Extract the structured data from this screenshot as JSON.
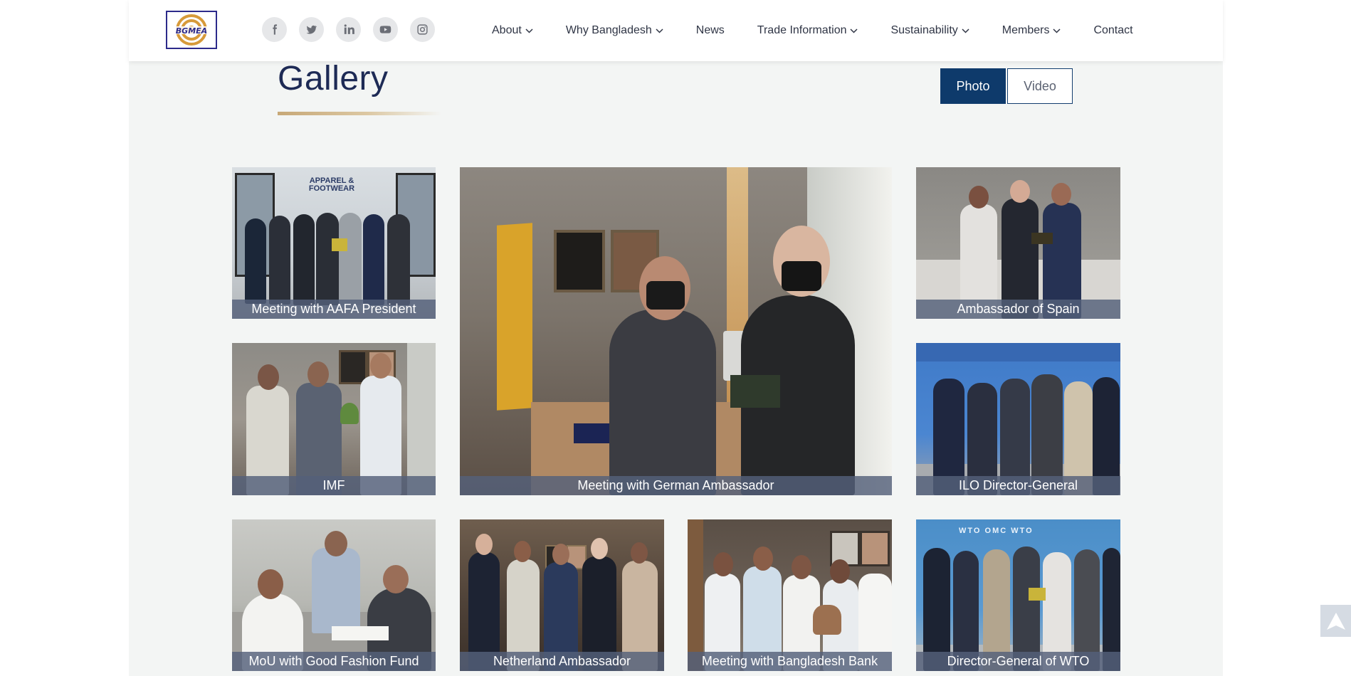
{
  "brand": {
    "logo_text": "BGMEA"
  },
  "nav": {
    "socials": [
      {
        "icon": "facebook-icon"
      },
      {
        "icon": "twitter-icon"
      },
      {
        "icon": "linkedin-icon"
      },
      {
        "icon": "youtube-icon"
      },
      {
        "icon": "instagram-icon"
      }
    ],
    "menu": [
      {
        "label": "About",
        "dropdown": true
      },
      {
        "label": "Why Bangladesh",
        "dropdown": true
      },
      {
        "label": "News",
        "dropdown": false
      },
      {
        "label": "Trade Information",
        "dropdown": true
      },
      {
        "label": "Sustainability",
        "dropdown": true
      },
      {
        "label": "Members",
        "dropdown": true
      },
      {
        "label": "Contact",
        "dropdown": false
      }
    ]
  },
  "gallery": {
    "title": "Gallery",
    "toggle": {
      "photo": "Photo",
      "video": "Video",
      "active": "Photo"
    },
    "items": [
      {
        "caption": "Meeting with AAFA President"
      },
      {
        "caption": "Meeting with German Ambassador"
      },
      {
        "caption": "Ambassador of Spain"
      },
      {
        "caption": "IMF"
      },
      {
        "caption": "ILO Director-General"
      },
      {
        "caption": "MoU with Good Fashion Fund"
      },
      {
        "caption": "Netherland Ambassador"
      },
      {
        "caption": "Meeting with Bangladesh Bank"
      },
      {
        "caption": "Director-General of WTO"
      }
    ]
  },
  "colors": {
    "navy": "#1d2a55",
    "toggle_active": "#0e3a6b",
    "accent_gold": "#c7a877",
    "page_bg": "#f3f5f4"
  },
  "scroll_top": {
    "icon": "arrow-up-icon"
  }
}
